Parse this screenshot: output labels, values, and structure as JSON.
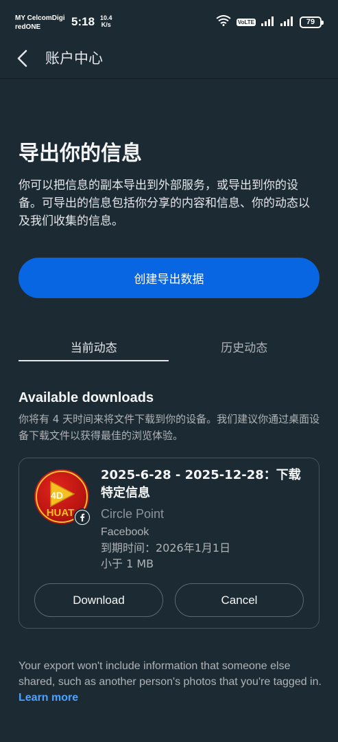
{
  "status_bar": {
    "carrier_line1": "MY CelcomDigi",
    "carrier_line2": "redONE",
    "time": "5:18",
    "net_speed_value": "10.4",
    "net_speed_unit": "K/s",
    "volte": "VoLTE",
    "battery": "79"
  },
  "header": {
    "back_icon": "chevron-left-icon",
    "title": "账户中心"
  },
  "main": {
    "title": "导出你的信息",
    "description": "你可以把信息的副本导出到外部服务，或导出到你的设备。可导出的信息包括你分享的内容和信息、你的动态以及我们收集的信息。",
    "create_button": "创建导出数据",
    "tabs": [
      {
        "label": "当前动态",
        "active": true
      },
      {
        "label": "历史动态",
        "active": false
      }
    ],
    "section_title": "Available downloads",
    "section_description": "你将有 4 天时间来将文件下载到你的设备。我们建议你通过桌面设备下载文件以获得最佳的浏览体验。"
  },
  "download_card": {
    "app_icon_text_top": "4D",
    "app_icon_text_bottom": "HUAT",
    "title": "2025-6-28 - 2025-12-28：下载特定信息",
    "source": "Circle Point",
    "platform": "Facebook",
    "expiry": "到期时间：2026年1月1日",
    "size": "小于 1 MB",
    "download_button": "Download",
    "cancel_button": "Cancel"
  },
  "footer": {
    "note": "Your export won't include information that someone else shared, such as another person's photos that you're tagged in.",
    "learn_more": "Learn more"
  },
  "colors": {
    "background": "#1c2b33",
    "accent": "#0866e3",
    "link": "#4ca3ff"
  }
}
